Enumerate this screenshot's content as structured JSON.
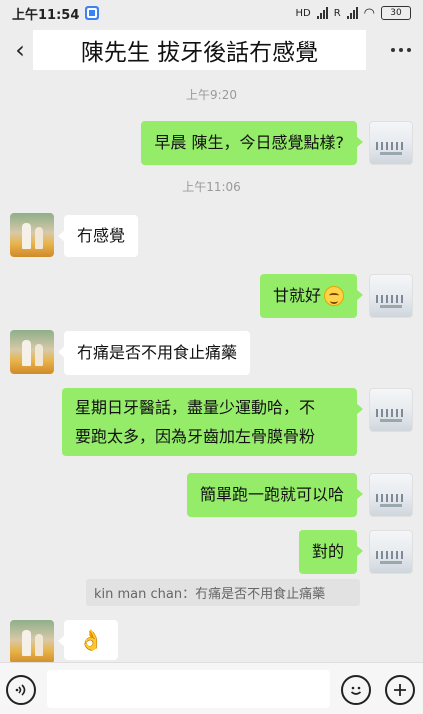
{
  "status_bar": {
    "time": "上午11:54",
    "battery": "30",
    "network_1": "HD",
    "network_2": "R"
  },
  "header": {
    "title": "陳先生 拔牙後話冇感覺"
  },
  "messages": [
    {
      "type": "timestamp",
      "text": "上午9:20"
    },
    {
      "type": "me",
      "text": "早晨 陳生，今日感覺點樣?"
    },
    {
      "type": "timestamp",
      "text": "上午11:06"
    },
    {
      "type": "them",
      "text": "冇感覺"
    },
    {
      "type": "me",
      "text": "甘就好",
      "emoji": "smile-emoji"
    },
    {
      "type": "them",
      "text": "冇痛是否不用食止痛藥"
    },
    {
      "type": "me",
      "line1": "星期日牙醫話，盡量少運動哈，不",
      "line2": "要跑太多，因為牙齒加左骨膜骨粉"
    },
    {
      "type": "me",
      "text": "簡單跑一跑就可以哈"
    },
    {
      "type": "me",
      "text": "對的"
    },
    {
      "type": "quote",
      "text": "kin man chan：冇痛是否不用食止痛藥"
    },
    {
      "type": "them",
      "emoji": "ok-hand-emoji",
      "text": "👌"
    }
  ],
  "input_bar": {
    "voice_icon": "voice-icon",
    "emoji_icon": "emoji-icon",
    "plus_icon": "plus-icon",
    "value": ""
  },
  "colors": {
    "background": "#ededed",
    "my_bubble": "#95ec69",
    "their_bubble": "#ffffff"
  }
}
